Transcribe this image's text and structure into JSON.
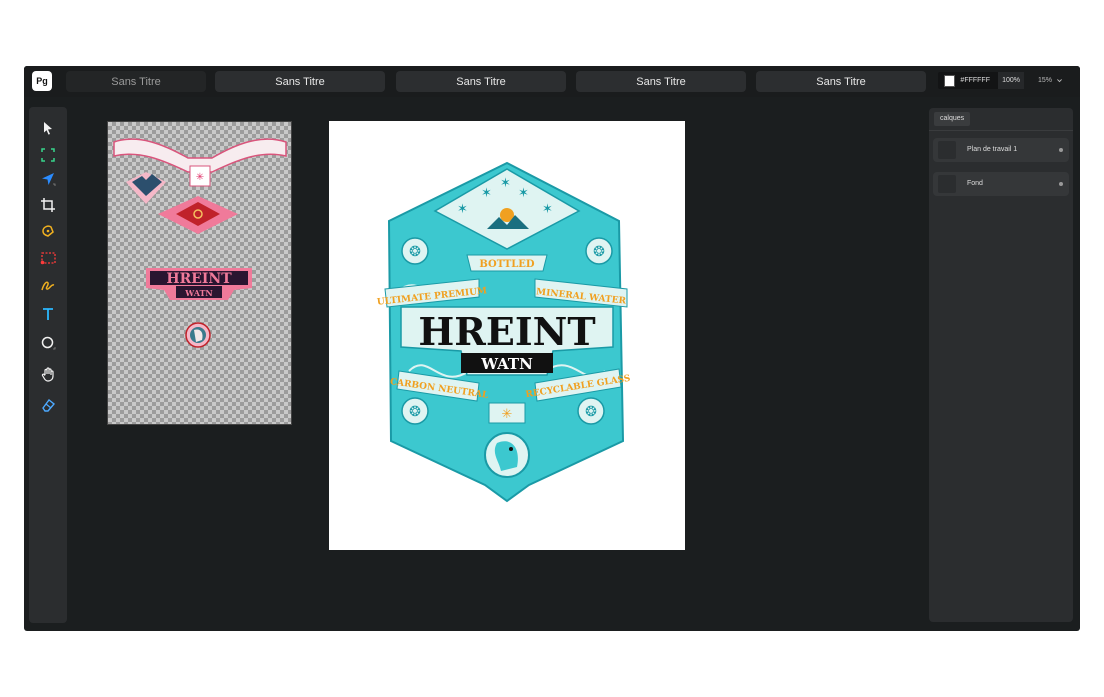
{
  "app": {
    "logo": "Pg"
  },
  "tabs": [
    {
      "label": "Sans Titre",
      "active": true
    },
    {
      "label": "Sans Titre"
    },
    {
      "label": "Sans Titre"
    },
    {
      "label": "Sans Titre"
    },
    {
      "label": "Sans Titre"
    }
  ],
  "fill": {
    "color": "#FFFFFF",
    "hex_label": "#FFFFFF",
    "opacity": "100%"
  },
  "zoom": {
    "value": "15%"
  },
  "tools": [
    {
      "name": "select-tool-icon"
    },
    {
      "name": "artboard-tool-icon"
    },
    {
      "name": "direct-select-tool-icon"
    },
    {
      "name": "crop-tool-icon"
    },
    {
      "name": "pen-tool-icon"
    },
    {
      "name": "marquee-tool-icon"
    },
    {
      "name": "brush-tool-icon"
    },
    {
      "name": "text-tool-icon"
    },
    {
      "name": "shape-tool-icon"
    },
    {
      "name": "hand-tool-icon"
    },
    {
      "name": "eraser-tool-icon"
    }
  ],
  "layers_panel": {
    "tab_label": "calques",
    "layers": [
      {
        "name": "Plan de travail 1"
      },
      {
        "name": "Fond"
      }
    ]
  },
  "label_art": {
    "brand": "HREINT",
    "sub": "WATN",
    "ribbon_top": "BOTTLED",
    "ribbon_left": "ULTIMATE PREMIUM",
    "ribbon_right": "MINERAL WATER",
    "ribbon_bottom_left": "CARBON NEUTRAL",
    "ribbon_bottom_right": "RECYCLABLE GLASS"
  },
  "colors": {
    "accent_teal": "#3cc8cf",
    "accent_orange": "#f0a020",
    "brand_dark": "#111111",
    "asset_pink": "#f07a9a",
    "asset_red": "#c0222a"
  }
}
